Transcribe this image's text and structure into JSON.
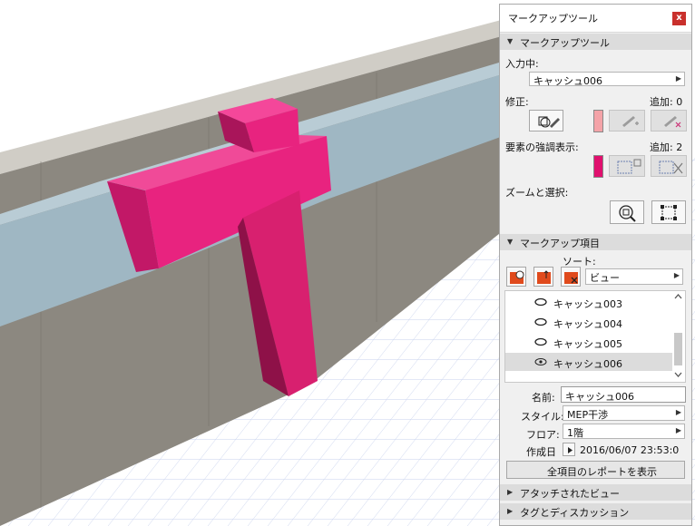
{
  "panel": {
    "title": "マークアップツール",
    "close_label": "x",
    "sections": {
      "markup_tool": "マークアップツール",
      "markup_items": "マークアップ項目",
      "attached_views": "アタッチされたビュー",
      "tags_discussion": "タグとディスカッション"
    },
    "input_label": "入力中:",
    "input_value": "キャッシュ006",
    "modify_label": "修正:",
    "add_count_label": "追加: 0",
    "highlight_label": "要素の強調表示:",
    "highlight_count_label": "追加: 2",
    "zoom_label": "ズームと選択:",
    "sort_label": "ソート:",
    "sort_value": "ビュー",
    "list_items": [
      {
        "label": "キャッシュ003",
        "selected": false
      },
      {
        "label": "キャッシュ004",
        "selected": false
      },
      {
        "label": "キャッシュ005",
        "selected": false
      },
      {
        "label": "キャッシュ006",
        "selected": true
      }
    ],
    "name_label": "名前:",
    "name_value": "キャッシュ006",
    "style_label": "スタイル:",
    "style_value": "MEP干渉",
    "floor_label": "フロア:",
    "floor_value": "1階",
    "created_label": "作成日",
    "created_value": "2016/06/07 23:53:0",
    "report_button": "全項目のレポートを表示"
  },
  "colors": {
    "magenta": "#e8237f",
    "correction_swatch": "#f4a3a8",
    "highlight_swatch": "#e0106e",
    "duct": "#9fb7c3",
    "wall": "#8c8880",
    "floor_grid": "#c9d3ee"
  }
}
